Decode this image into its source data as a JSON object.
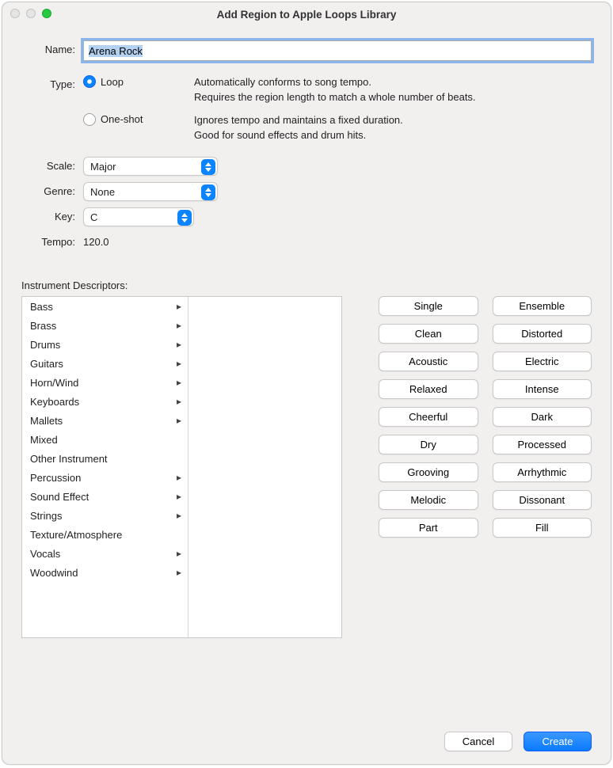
{
  "window_title": "Add Region to Apple Loops Library",
  "labels": {
    "name": "Name:",
    "type": "Type:",
    "scale": "Scale:",
    "genre": "Genre:",
    "key": "Key:",
    "tempo": "Tempo:",
    "section": "Instrument Descriptors:"
  },
  "name_value": "Arena Rock",
  "type_options": {
    "loop": {
      "label": "Loop",
      "desc": "Automatically conforms to song tempo.\nRequires the region length to match a whole number of beats."
    },
    "oneshot": {
      "label": "One-shot",
      "desc": "Ignores tempo and maintains a fixed duration.\nGood for sound effects and drum hits."
    }
  },
  "scale_value": "Major",
  "genre_value": "None",
  "key_value": "C",
  "tempo_value": "120.0",
  "instrument_categories": [
    {
      "label": "Bass",
      "has_children": true
    },
    {
      "label": "Brass",
      "has_children": true
    },
    {
      "label": "Drums",
      "has_children": true
    },
    {
      "label": "Guitars",
      "has_children": true
    },
    {
      "label": "Horn/Wind",
      "has_children": true
    },
    {
      "label": "Keyboards",
      "has_children": true
    },
    {
      "label": "Mallets",
      "has_children": true
    },
    {
      "label": "Mixed",
      "has_children": false
    },
    {
      "label": "Other Instrument",
      "has_children": false
    },
    {
      "label": "Percussion",
      "has_children": true
    },
    {
      "label": "Sound Effect",
      "has_children": true
    },
    {
      "label": "Strings",
      "has_children": true
    },
    {
      "label": "Texture/Atmosphere",
      "has_children": false
    },
    {
      "label": "Vocals",
      "has_children": true
    },
    {
      "label": "Woodwind",
      "has_children": true
    }
  ],
  "tag_pairs": [
    [
      "Single",
      "Ensemble"
    ],
    [
      "Clean",
      "Distorted"
    ],
    [
      "Acoustic",
      "Electric"
    ],
    [
      "Relaxed",
      "Intense"
    ],
    [
      "Cheerful",
      "Dark"
    ],
    [
      "Dry",
      "Processed"
    ],
    [
      "Grooving",
      "Arrhythmic"
    ],
    [
      "Melodic",
      "Dissonant"
    ],
    [
      "Part",
      "Fill"
    ]
  ],
  "buttons": {
    "cancel": "Cancel",
    "create": "Create"
  }
}
